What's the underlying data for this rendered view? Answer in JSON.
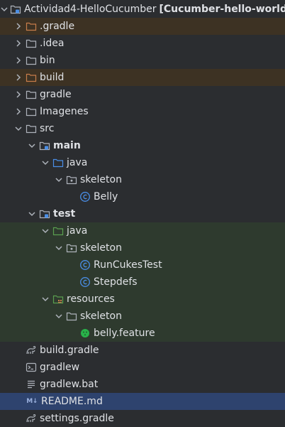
{
  "project": {
    "name": "Actividad4-HelloCucumber",
    "module": "[Cucumber-hello-world]"
  },
  "items": {
    "gradle_hidden": ".gradle",
    "idea": ".idea",
    "bin": "bin",
    "build": "build",
    "gradle": "gradle",
    "imagenes": "Imagenes",
    "src": "src",
    "main": "main",
    "main_java": "java",
    "main_skeleton": "skeleton",
    "belly": "Belly",
    "test": "test",
    "test_java": "java",
    "test_skeleton": "skeleton",
    "runcukes": "RunCukesTest",
    "stepdefs": "Stepdefs",
    "resources": "resources",
    "res_skeleton": "skeleton",
    "feature": "belly.feature",
    "build_gradle": "build.gradle",
    "gradlew": "gradlew",
    "gradlew_bat": "gradlew.bat",
    "readme": "README.md",
    "settings_gradle": "settings.gradle"
  },
  "icons": {
    "readme_badge": "M↓"
  },
  "colors": {
    "background": "#2b2d30",
    "excluded_row": "#3d3223",
    "test_row": "#2e3a2e",
    "selected_row": "#2e436e",
    "excluded_folder": "#c77d4a",
    "source_folder": "#4a8ee6",
    "test_folder": "#5a9e4f",
    "class_icon": "#4a8ee6",
    "feature_icon": "#29b24a"
  }
}
